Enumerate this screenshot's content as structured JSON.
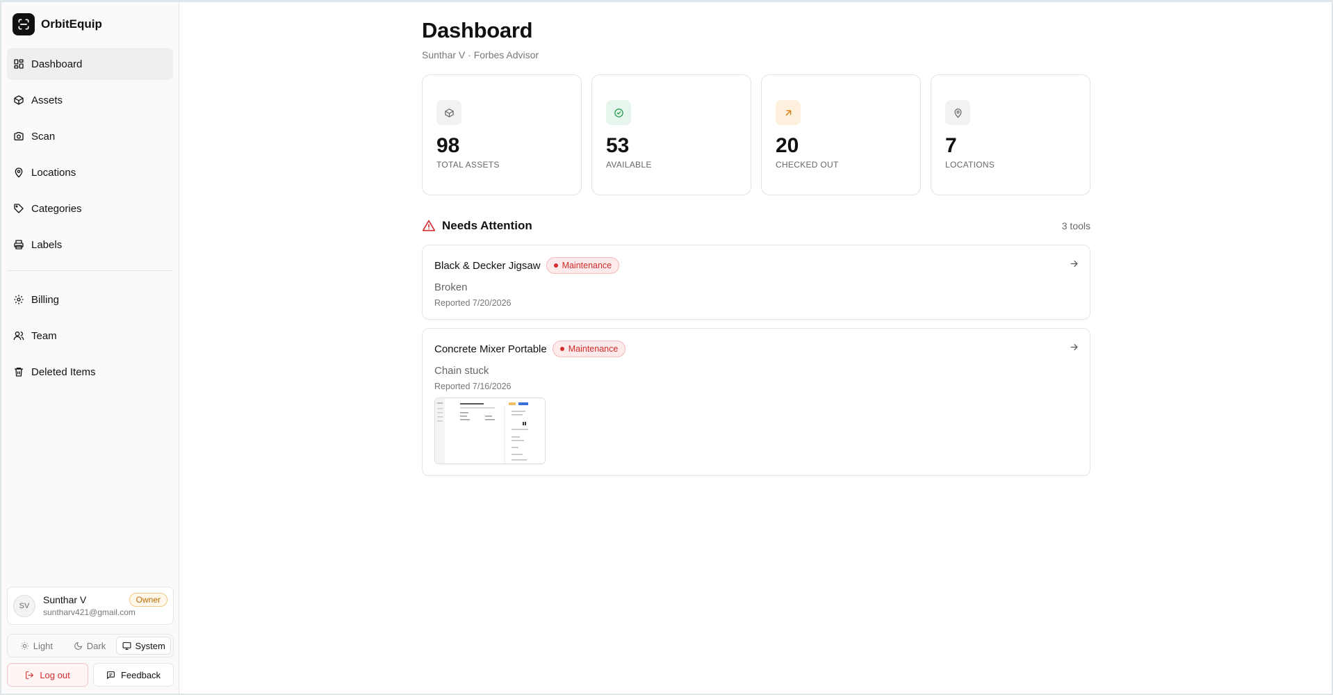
{
  "app": {
    "name": "OrbitEquip"
  },
  "sidebar": {
    "items": [
      {
        "label": "Dashboard",
        "icon": "layout-grid-icon",
        "active": true
      },
      {
        "label": "Assets",
        "icon": "box-icon"
      },
      {
        "label": "Scan",
        "icon": "camera-icon"
      },
      {
        "label": "Locations",
        "icon": "map-pin-icon"
      },
      {
        "label": "Categories",
        "icon": "tag-icon"
      },
      {
        "label": "Labels",
        "icon": "printer-icon"
      }
    ],
    "secondary": [
      {
        "label": "Billing",
        "icon": "gear-icon"
      },
      {
        "label": "Team",
        "icon": "users-icon"
      },
      {
        "label": "Deleted Items",
        "icon": "trash-icon"
      }
    ],
    "user": {
      "initials": "SV",
      "name": "Sunthar V",
      "email": "suntharv421@gmail.com",
      "role": "Owner"
    },
    "theme": {
      "options": [
        "Light",
        "Dark",
        "System"
      ],
      "selected": "System"
    },
    "logout_label": "Log out",
    "feedback_label": "Feedback"
  },
  "page": {
    "title": "Dashboard",
    "subtitle": "Sunthar V · Forbes Advisor"
  },
  "stats": [
    {
      "value": "98",
      "label": "TOTAL ASSETS",
      "icon": "box-icon",
      "color": "#666666",
      "bg": "#f2f2f2"
    },
    {
      "value": "53",
      "label": "AVAILABLE",
      "icon": "check-circle-icon",
      "color": "#1f9a4a",
      "bg": "#e6f6ec"
    },
    {
      "value": "20",
      "label": "CHECKED OUT",
      "icon": "arrow-up-right-icon",
      "color": "#d97706",
      "bg": "#fdf0dc"
    },
    {
      "value": "7",
      "label": "LOCATIONS",
      "icon": "map-pin-icon",
      "color": "#666666",
      "bg": "#f2f2f2"
    }
  ],
  "attention": {
    "title": "Needs Attention",
    "count": "3 tools",
    "items": [
      {
        "name": "Black & Decker Jigsaw",
        "status": "Maintenance",
        "description": "Broken",
        "reported": "Reported 7/20/2026",
        "has_image": false
      },
      {
        "name": "Concrete Mixer Portable",
        "status": "Maintenance",
        "description": "Chain stuck",
        "reported": "Reported 7/16/2026",
        "has_image": true
      }
    ]
  }
}
